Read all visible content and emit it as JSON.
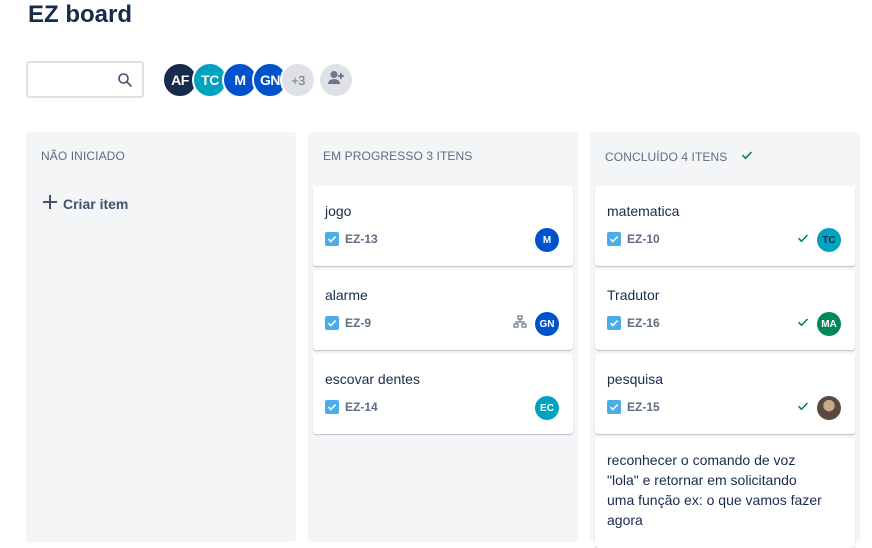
{
  "board": {
    "title": "EZ board"
  },
  "search": {
    "placeholder": ""
  },
  "avatars": [
    {
      "initials": "AF",
      "color": "#172b4d"
    },
    {
      "initials": "TC",
      "color": "#00a3bf"
    },
    {
      "initials": "M",
      "color": "#0052cc"
    },
    {
      "initials": "GN",
      "color": "#0052cc"
    }
  ],
  "avatar_more": "+3",
  "columns": [
    {
      "title": "NÃO INICIADO",
      "create_label": "Criar item"
    },
    {
      "title": "EM PROGRESSO 3 ITENS"
    },
    {
      "title": "CONCLUÍDO 4 ITENS"
    }
  ],
  "cards": {
    "progress": [
      {
        "summary": "jogo",
        "key": "EZ-13",
        "assignee": "M",
        "color": "#0052cc"
      },
      {
        "summary": "alarme",
        "key": "EZ-9",
        "assignee": "GN",
        "color": "#0052cc"
      },
      {
        "summary": "escovar dentes",
        "key": "EZ-14",
        "assignee": "EC",
        "color": "#00a3bf"
      }
    ],
    "done": [
      {
        "summary": "matematica",
        "key": "EZ-10",
        "assignee": "TC",
        "color": "#00a3bf"
      },
      {
        "summary": "Tradutor",
        "key": "EZ-16",
        "assignee": "MA",
        "color": "#00875a"
      },
      {
        "summary": "pesquisa",
        "key": "EZ-15",
        "assignee": "",
        "color": "#7a6a5a"
      },
      {
        "summary": "reconhecer o comando de voz \"lola\" e retornar em solicitando uma função ex: o que vamos fazer agora"
      }
    ]
  },
  "colors": {
    "done_check": "#36b37e",
    "checkbox": "#4bade8",
    "column_bg": "#f4f5f7"
  }
}
